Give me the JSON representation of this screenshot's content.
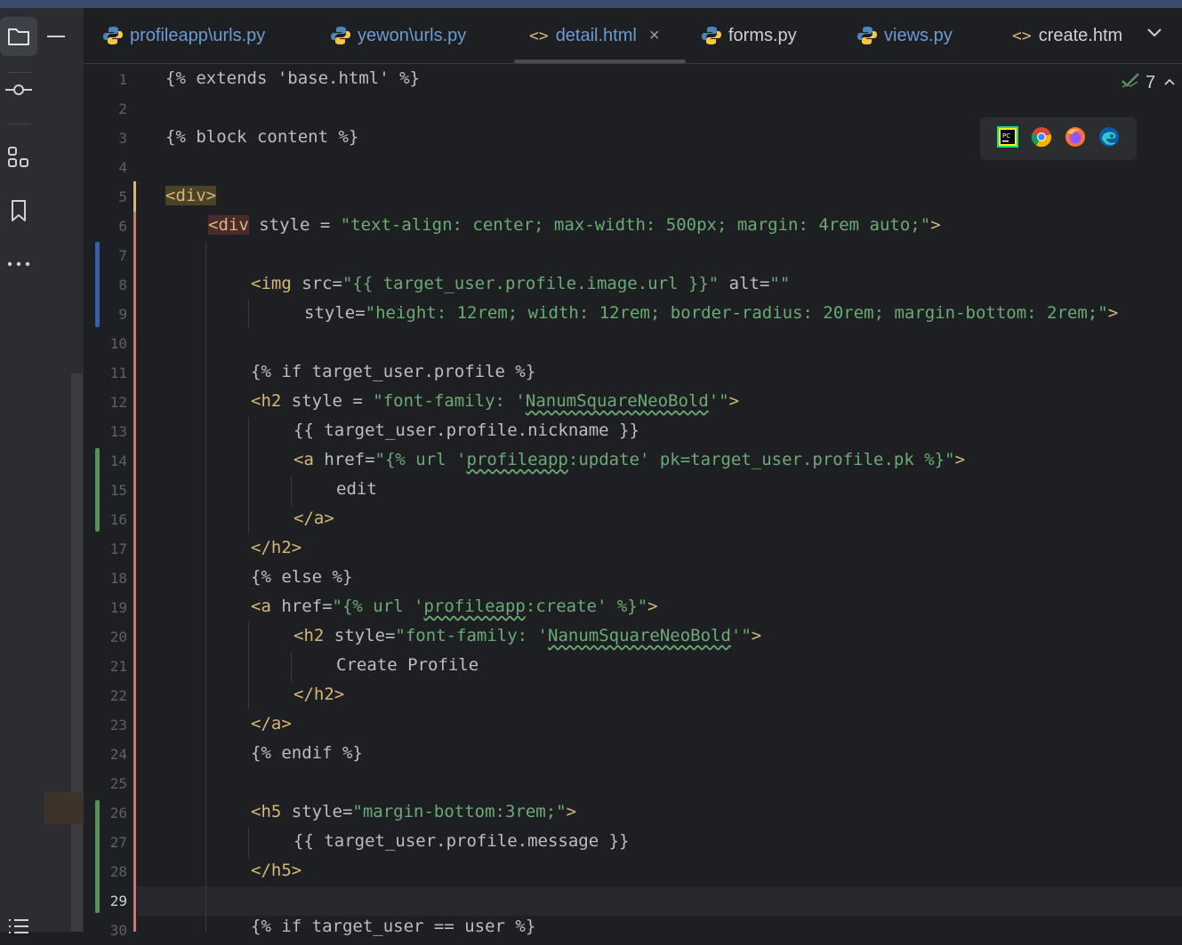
{
  "tabs": [
    {
      "label": "profileapp\\urls.py",
      "type": "python",
      "color": "#6c9bd2"
    },
    {
      "label": "yewon\\urls.py",
      "type": "python",
      "color": "#6c9bd2"
    },
    {
      "label": "detail.html",
      "type": "html",
      "color": "#6c9bd2",
      "active": true,
      "close": "×"
    },
    {
      "label": "forms.py",
      "type": "python",
      "color": "#ced0d6"
    },
    {
      "label": "views.py",
      "type": "python",
      "color": "#6c9bd2"
    },
    {
      "label": "create.htm",
      "type": "html",
      "color": "#ced0d6"
    }
  ],
  "inspection": {
    "count": "7"
  },
  "line_numbers": [
    "1",
    "2",
    "3",
    "4",
    "5",
    "6",
    "7",
    "8",
    "9",
    "10",
    "11",
    "12",
    "13",
    "14",
    "15",
    "16",
    "17",
    "18",
    "19",
    "20",
    "21",
    "22",
    "23",
    "24",
    "25",
    "26",
    "27",
    "28",
    "29",
    "30"
  ],
  "current_line": "29",
  "code": {
    "l1": "{% extends 'base.html' %}",
    "l3": "{% block content %}",
    "l5_tag": "<div>",
    "l6_tag": "<div",
    "l6_attr": " style = ",
    "l6_str": "\"text-align: center; max-width: 500px; margin: 4rem auto;\"",
    "l6_end": ">",
    "l8_tag": "<img",
    "l8_attr": " src=",
    "l8_str1": "\"{{ target_user.profile.image.url }}\"",
    "l8_attr2": " alt=",
    "l8_str2": "\"\"",
    "l9_attr": "style=",
    "l9_str": "\"height: 12rem; width: 12rem; border-radius: 20rem; margin-bottom: 2rem;\"",
    "l9_end": ">",
    "l11": "{% if target_user.profile %}",
    "l12_tag": "<h2",
    "l12_attr": " style = ",
    "l12_str_a": "\"font-family: '",
    "l12_sq": "NanumSquareNeoBold",
    "l12_str_b": "'\"",
    "l12_end": ">",
    "l13": "{{ target_user.profile.nickname }}",
    "l14_tag": "<a",
    "l14_attr": " href=",
    "l14_str_a": "\"{% url '",
    "l14_sq": "profileapp",
    "l14_str_b": ":update' pk=target_user.profile.pk %}\"",
    "l14_end": ">",
    "l15": "edit",
    "l16": "</a>",
    "l17": "</h2>",
    "l18": "{% else %}",
    "l19_tag": "<a",
    "l19_attr": " href=",
    "l19_str_a": "\"{% url '",
    "l19_sq": "profileapp",
    "l19_str_b": ":create' %}\"",
    "l19_end": ">",
    "l20_tag": "<h2",
    "l20_attr": " style=",
    "l20_str_a": "\"font-family: '",
    "l20_sq": "NanumSquareNeoBold",
    "l20_str_b": "'\"",
    "l20_end": ">",
    "l21": "Create Profile",
    "l22": "</h2>",
    "l23": "</a>",
    "l24": "{% endif %}",
    "l26_tag": "<h5",
    "l26_attr": " style=",
    "l26_str": "\"margin-bottom:3rem;\"",
    "l26_end": ">",
    "l27": "{{ target_user.profile.message }}",
    "l28": "</h5>",
    "l30": "{% if target_user == user %}"
  },
  "browsers": [
    "pycharm-icon",
    "chrome-icon",
    "firefox-icon",
    "edge-icon"
  ],
  "colors": {
    "tag": "#d5b778",
    "string": "#6aab73",
    "text": "#bcbec4",
    "added": "#549159",
    "modified": "#375fad"
  }
}
